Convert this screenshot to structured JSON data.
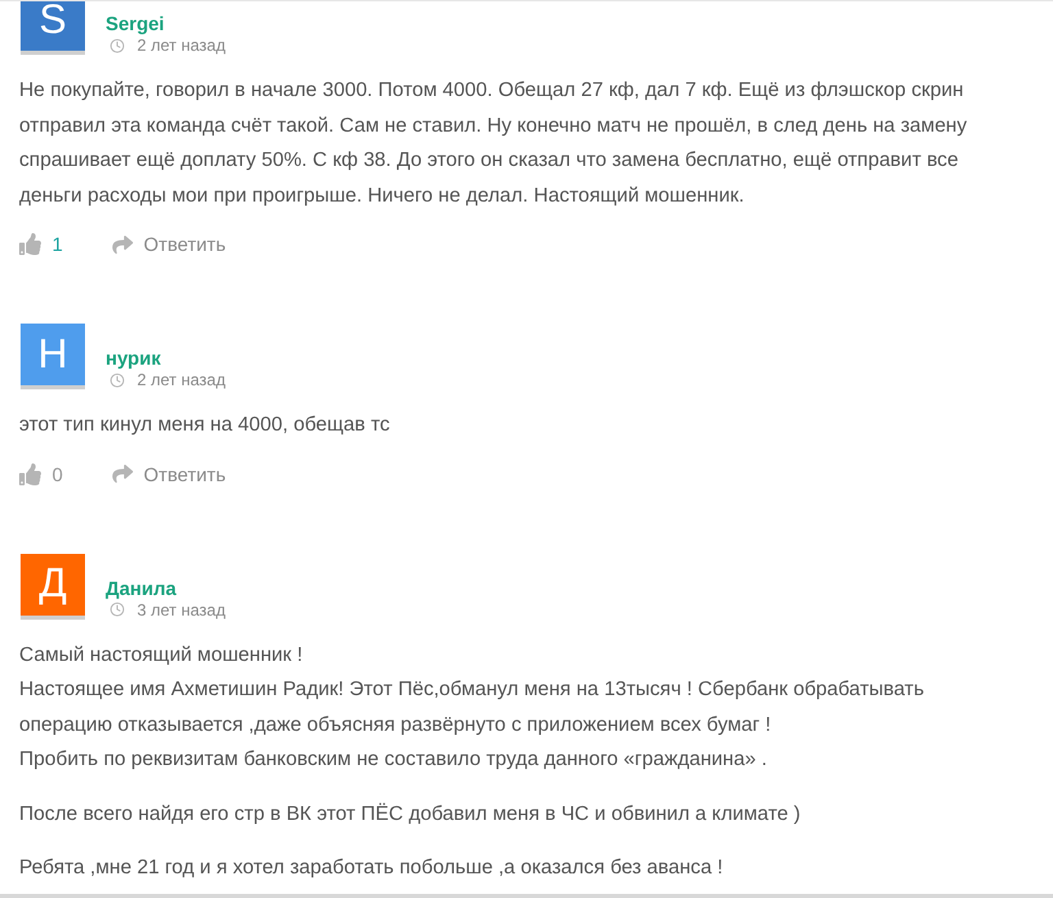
{
  "comments": [
    {
      "avatar_letter": "S",
      "color": "#3a7bc8",
      "author": "Sergei",
      "time": "2 лет назад",
      "paragraphs": [
        [
          "Не покупайте, говорил в начале 3000. Потом 4000. Обещал 27 кф, дал 7 кф. Ещё из флэшскор скрин",
          "отправил эта команда счёт такой. Сам не ставил. Ну конечно матч не прошёл, в след день на замену",
          "спрашивает ещё доплату 50%. С кф 38. До этого он сказал что замена бесплатно, ещё отправит все",
          "деньги расходы мои при проигрыше. Ничего не делал. Настоящий мошенник."
        ]
      ],
      "likes": "1",
      "likes_highlighted": true,
      "reply": "Ответить"
    },
    {
      "avatar_letter": "Н",
      "color": "#4f9ded",
      "author": "нурик",
      "time": "2 лет назад",
      "paragraphs": [
        [
          "этот тип кинул меня на 4000, обещав тс"
        ]
      ],
      "likes": "0",
      "likes_highlighted": false,
      "reply": "Ответить"
    },
    {
      "avatar_letter": "Д",
      "color": "#ff6600",
      "author": "Данила",
      "time": "3 лет назад",
      "paragraphs": [
        [
          "Самый настоящий мошенник !",
          "Настоящее имя Ахметишин Радик! Этот Пёс,обманул меня на 13тысяч ! Сбербанк обрабатывать",
          "операцию отказывается ,даже объясняя развёрнуто с приложением всех бумаг !",
          "Пробить по реквизитам банковским не составило труда данного «гражданина» ."
        ],
        [
          "После всего найдя его стр в ВК этот ПЁС добавил меня в ЧС и обвинил а климате )"
        ],
        [
          "Ребята ,мне 21 год и я хотел заработать побольше ,а оказался без аванса !"
        ]
      ]
    }
  ]
}
